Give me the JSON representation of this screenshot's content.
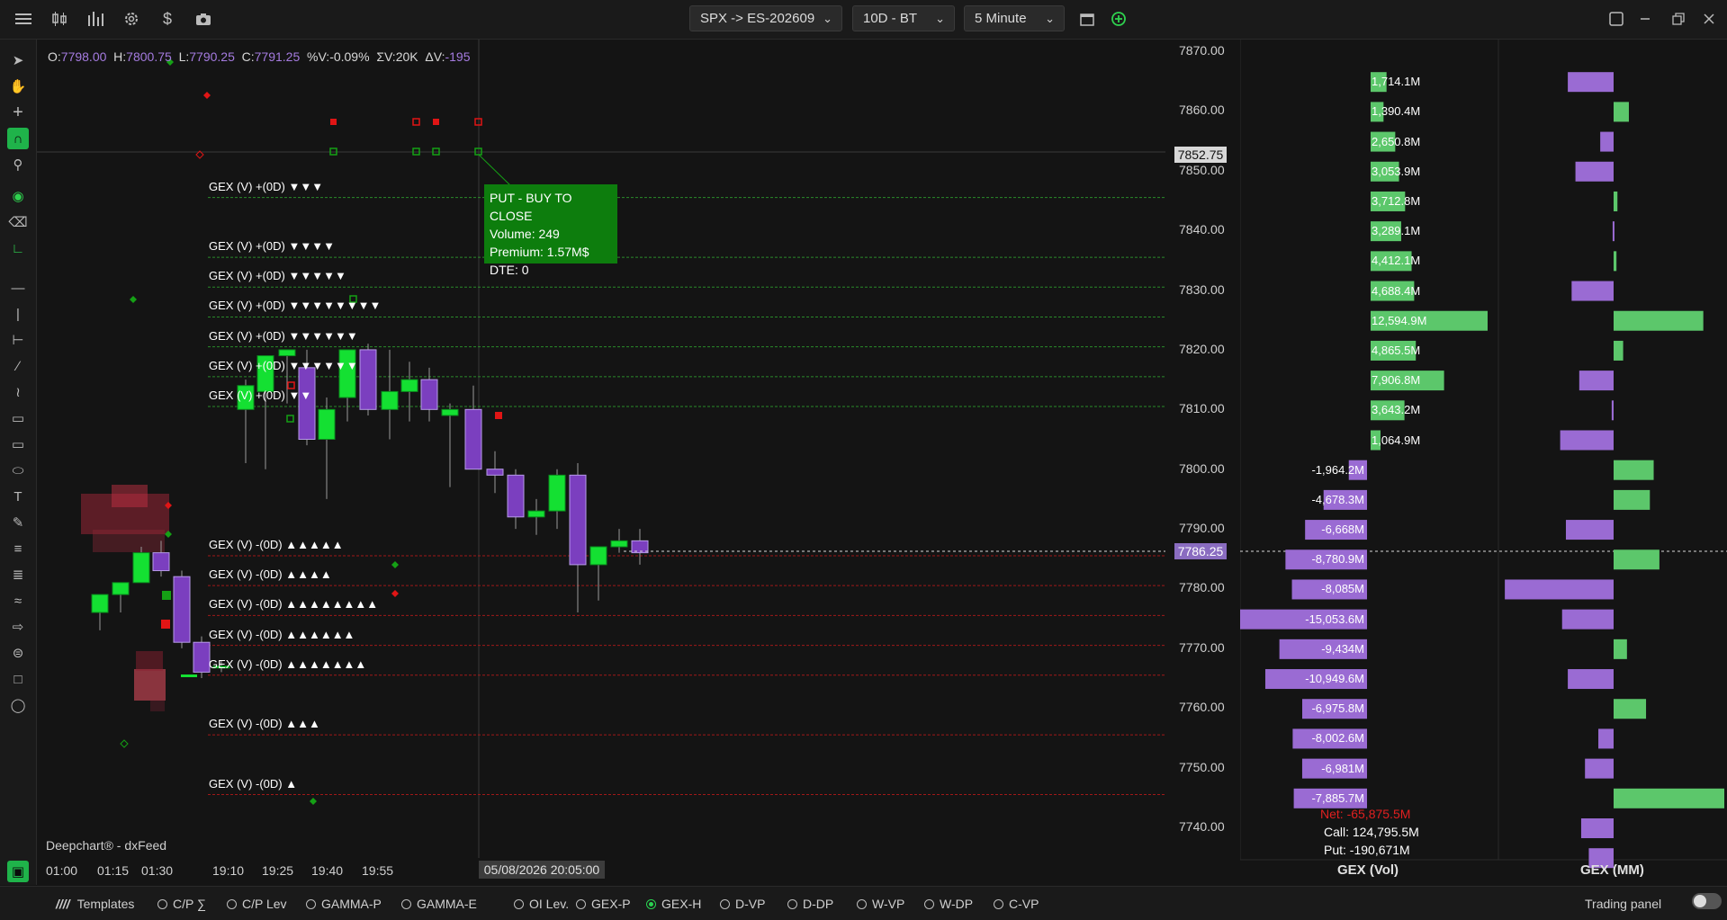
{
  "topbar": {
    "symbol": "SPX -> ES-202609",
    "range": "10D - BT",
    "interval": "5 Minute",
    "icons": [
      "menu-icon",
      "candles-icon",
      "bars-icon",
      "gear-icon",
      "dollar-icon",
      "camera-icon"
    ],
    "right_icons": [
      "calendar-icon",
      "add-circle-icon"
    ],
    "window_icons": [
      "layout-icon",
      "minimize-icon",
      "restore-icon",
      "close-icon"
    ]
  },
  "ohlc": {
    "o_label": "O:",
    "o": "7798.00",
    "h_label": "H:",
    "h": "7800.75",
    "l_label": "L:",
    "l": "7790.25",
    "c_label": "C:",
    "c": "7791.25",
    "pv_label": "%V:",
    "pv": "-0.09%",
    "sv_label": "ΣV:",
    "sv": "20K",
    "dv_label": "ΔV:",
    "dv": "-195"
  },
  "gex_levels": [
    {
      "label": "GEX (V) +(0D)",
      "marks": "▼▼▼",
      "price": 7847
    },
    {
      "label": "GEX (V) +(0D)",
      "marks": "▼▼▼▼",
      "price": 7837
    },
    {
      "label": "GEX (V) +(0D)",
      "marks": "▼▼▼▼▼",
      "price": 7832
    },
    {
      "label": "GEX (V) +(0D)",
      "marks": "▼▼▼▼▼▼▼▼",
      "price": 7827
    },
    {
      "label": "GEX (V) +(0D)",
      "marks": "▼▼▼▼▼▼",
      "price": 7822
    },
    {
      "label": "GEX (V) +(0D)",
      "marks": "▼▼▼▼▼▼",
      "price": 7817
    },
    {
      "label": "GEX (V) +(0D)",
      "marks": "▼▼",
      "price": 7812
    },
    {
      "label": "GEX (V) -(0D)",
      "marks": "▲▲▲▲▲",
      "price": 7787
    },
    {
      "label": "GEX (V) -(0D)",
      "marks": "▲▲▲▲",
      "price": 7782
    },
    {
      "label": "GEX (V) -(0D)",
      "marks": "▲▲▲▲▲▲▲▲",
      "price": 7777
    },
    {
      "label": "GEX (V) -(0D)",
      "marks": "▲▲▲▲▲▲",
      "price": 7772
    },
    {
      "label": "GEX (V) -(0D)",
      "marks": "▲▲▲▲▲▲▲",
      "price": 7767
    },
    {
      "label": "GEX (V) -(0D)",
      "marks": "▲▲▲",
      "price": 7757
    },
    {
      "label": "GEX (V) -(0D)",
      "marks": "▲",
      "price": 7747
    }
  ],
  "tooltip": {
    "line1": "PUT - BUY TO CLOSE",
    "line2": "Volume: 249",
    "line3": "Premium: 1.57M$",
    "line4": "DTE: 0"
  },
  "watermark": "Deepchart® - dxFeed",
  "price_axis": {
    "labels": [
      "7870.00",
      "7860.00",
      "7850.00",
      "7840.00",
      "7830.00",
      "7820.00",
      "7810.00",
      "7800.00",
      "7790.00",
      "7780.00",
      "7770.00",
      "7760.00",
      "7750.00",
      "7740.00"
    ],
    "crosshair_price": "7852.75",
    "last_price": "7786.25"
  },
  "time_axis": {
    "labels": [
      "01:00",
      "01:15",
      "01:30",
      "19:10",
      "19:25",
      "19:40",
      "19:55"
    ],
    "crosshair_time": "05/08/2026 20:05:00"
  },
  "chart_data": {
    "type": "candlestick",
    "ylim": [
      7734,
      7872
    ],
    "candles": [
      {
        "o": 7776,
        "h": 7778,
        "l": 7773,
        "c": 7779
      },
      {
        "o": 7779,
        "h": 7781,
        "l": 7776,
        "c": 7781
      },
      {
        "o": 7781,
        "h": 7787,
        "l": 7781,
        "c": 7786
      },
      {
        "o": 7786,
        "h": 7788,
        "l": 7782,
        "c": 7783
      },
      {
        "o": 7782,
        "h": 7783,
        "l": 7770,
        "c": 7771
      },
      {
        "o": 7771,
        "h": 7772,
        "l": 7765,
        "c": 7766
      },
      {
        "o": 7767,
        "h": 7768,
        "l": 7766,
        "c": 7767
      },
      {
        "o": 7810,
        "h": 7815,
        "l": 7801,
        "c": 7814
      },
      {
        "o": 7813,
        "h": 7818,
        "l": 7800,
        "c": 7819
      },
      {
        "o": 7819,
        "h": 7820,
        "l": 7811,
        "c": 7820
      },
      {
        "o": 7817,
        "h": 7820,
        "l": 7804,
        "c": 7805
      },
      {
        "o": 7805,
        "h": 7812,
        "l": 7795,
        "c": 7810
      },
      {
        "o": 7812,
        "h": 7820,
        "l": 7808,
        "c": 7820
      },
      {
        "o": 7820,
        "h": 7821,
        "l": 7809,
        "c": 7810
      },
      {
        "o": 7810,
        "h": 7820,
        "l": 7805,
        "c": 7813
      },
      {
        "o": 7813,
        "h": 7818,
        "l": 7808,
        "c": 7815
      },
      {
        "o": 7815,
        "h": 7817,
        "l": 7808,
        "c": 7810
      },
      {
        "o": 7809,
        "h": 7811,
        "l": 7797,
        "c": 7810
      },
      {
        "o": 7810,
        "h": 7814,
        "l": 7800,
        "c": 7800
      },
      {
        "o": 7800,
        "h": 7803,
        "l": 7796,
        "c": 7799
      },
      {
        "o": 7799,
        "h": 7800,
        "l": 7790,
        "c": 7792
      },
      {
        "o": 7792,
        "h": 7795,
        "l": 7789,
        "c": 7793
      },
      {
        "o": 7793,
        "h": 7800,
        "l": 7790,
        "c": 7799
      },
      {
        "o": 7799,
        "h": 7801,
        "l": 7776,
        "c": 7784
      },
      {
        "o": 7784,
        "h": 7785,
        "l": 7778,
        "c": 7787
      },
      {
        "o": 7787,
        "h": 7790,
        "l": 7786,
        "c": 7788
      },
      {
        "o": 7788,
        "h": 7790,
        "l": 7784,
        "c": 7786
      }
    ]
  },
  "gex_vol": [
    {
      "price": 7865,
      "label": "1,714.1M",
      "value": 1714
    },
    {
      "price": 7860,
      "label": "1,390.4M",
      "value": 1390
    },
    {
      "price": 7855,
      "label": "2,650.8M",
      "value": 2651
    },
    {
      "price": 7850,
      "label": "3,053.9M",
      "value": 3054
    },
    {
      "price": 7845,
      "label": "3,712.8M",
      "value": 3713
    },
    {
      "price": 7840,
      "label": "3,289.1M",
      "value": 3289
    },
    {
      "price": 7835,
      "label": "4,412.1M",
      "value": 4412
    },
    {
      "price": 7830,
      "label": "4,688.4M",
      "value": 4688
    },
    {
      "price": 7825,
      "label": "12,594.9M",
      "value": 12595
    },
    {
      "price": 7820,
      "label": "4,865.5M",
      "value": 4866
    },
    {
      "price": 7815,
      "label": "7,906.8M",
      "value": 7907
    },
    {
      "price": 7810,
      "label": "3,643.2M",
      "value": 3643
    },
    {
      "price": 7805,
      "label": "1,064.9M",
      "value": 1065
    },
    {
      "price": 7800,
      "label": "-1,964.2M",
      "value": -1964
    },
    {
      "price": 7795,
      "label": "-4,678.3M",
      "value": -4678
    },
    {
      "price": 7790,
      "label": "-6,668M",
      "value": -6668
    },
    {
      "price": 7785,
      "label": "-8,780.9M",
      "value": -8781
    },
    {
      "price": 7780,
      "label": "-8,085M",
      "value": -8085
    },
    {
      "price": 7775,
      "label": "-15,053.6M",
      "value": -15054
    },
    {
      "price": 7770,
      "label": "-9,434M",
      "value": -9434
    },
    {
      "price": 7765,
      "label": "-10,949.6M",
      "value": -10950
    },
    {
      "price": 7760,
      "label": "-6,975.8M",
      "value": -6976
    },
    {
      "price": 7755,
      "label": "-8,002.6M",
      "value": -8003
    },
    {
      "price": 7750,
      "label": "-6,981M",
      "value": -6981
    },
    {
      "price": 7745,
      "label": "-7,885.7M",
      "value": -7886
    }
  ],
  "gex_mm": [
    {
      "price": 7865,
      "value": -2400
    },
    {
      "price": 7860,
      "value": 800
    },
    {
      "price": 7855,
      "value": -700
    },
    {
      "price": 7850,
      "value": -2000
    },
    {
      "price": 7845,
      "value": 200
    },
    {
      "price": 7840,
      "value": -50
    },
    {
      "price": 7835,
      "value": 150
    },
    {
      "price": 7830,
      "value": -2200
    },
    {
      "price": 7825,
      "value": 4700
    },
    {
      "price": 7820,
      "value": 500
    },
    {
      "price": 7815,
      "value": -1800
    },
    {
      "price": 7810,
      "value": -100
    },
    {
      "price": 7805,
      "value": -2800
    },
    {
      "price": 7800,
      "value": 2100
    },
    {
      "price": 7795,
      "value": 1900
    },
    {
      "price": 7790,
      "value": -2500
    },
    {
      "price": 7785,
      "value": 2400
    },
    {
      "price": 7780,
      "value": -5700
    },
    {
      "price": 7775,
      "value": -2700
    },
    {
      "price": 7770,
      "value": 700
    },
    {
      "price": 7765,
      "value": -2400
    },
    {
      "price": 7760,
      "value": 1700
    },
    {
      "price": 7755,
      "value": -800
    },
    {
      "price": 7750,
      "value": -1500
    },
    {
      "price": 7745,
      "value": 5800
    },
    {
      "price": 7740,
      "value": -1700
    },
    {
      "price": 7735,
      "value": -1300
    }
  ],
  "gex_summary": {
    "net": "Net: -65,875.5M",
    "call": "Call: 124,795.5M",
    "put": "Put: -190,671M"
  },
  "panel_titles": {
    "vol": "GEX (Vol)",
    "mm": "GEX (MM)"
  },
  "colors": {
    "bull": "#14e032",
    "bear": "#7b3fbf",
    "gex_pos": "#5cc76b",
    "gex_neg": "#9a6bd3",
    "level_pos": "#2a8a2a",
    "level_neg": "#a01818",
    "net": "#e02020"
  },
  "bottombar": {
    "templates": "Templates",
    "options": [
      "C/P ∑",
      "C/P Lev",
      "GAMMA-P",
      "GAMMA-E",
      "OI Lev.",
      "GEX-P",
      "GEX-H",
      "D-VP",
      "D-DP",
      "W-VP",
      "W-DP",
      "C-VP"
    ],
    "selected": "GEX-H",
    "trading_panel": "Trading panel"
  }
}
